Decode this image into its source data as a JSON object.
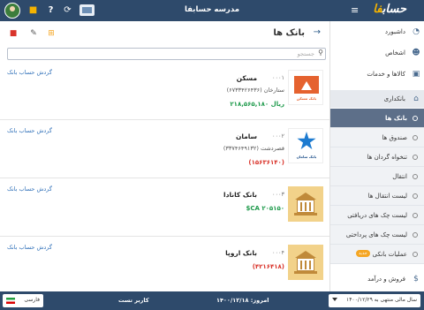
{
  "header": {
    "app_title": "مدرسه حسابفا",
    "logo_text_main": "حساب",
    "logo_text_accent": "فا"
  },
  "sidebar": {
    "items": [
      {
        "label": "داشبورد",
        "icon": "dashboard-icon"
      },
      {
        "label": "اشخاص",
        "icon": "people-icon"
      },
      {
        "label": "کالاها و خدمات",
        "icon": "products-icon"
      },
      {
        "label": "بانکداری",
        "icon": "bank-icon"
      }
    ],
    "sub_items": [
      {
        "label": "بانک ها",
        "active": true
      },
      {
        "label": "صندوق ها"
      },
      {
        "label": "تنخواه گردان ها"
      },
      {
        "label": "انتقال"
      },
      {
        "label": "لیست انتقال ها"
      },
      {
        "label": "لیست چک های دریافتی"
      },
      {
        "label": "لیست چک های پرداختی"
      },
      {
        "label": "عملیات بانکی",
        "badge": "جدید"
      }
    ],
    "bottom_item": {
      "label": "فروش و درآمد",
      "icon": "sales-icon"
    }
  },
  "main": {
    "page_title": "بانک ها",
    "search_placeholder": "جستجو",
    "banks": [
      {
        "code": "۰۰۰۱",
        "name": "مسکن",
        "branch": "ستارخان (۶۷۳۳۴۲۶۴۳۶)",
        "balance": "ریال ۲۱۸,۵۶۵,۱۸۰",
        "balance_color": "green",
        "logo": "maskan",
        "turnover": "گردش حساب بانک"
      },
      {
        "code": "۰۰۰۲",
        "name": "سامان",
        "branch": "قصردشت (۳۳۷۴۶۴۹۱۳۲)",
        "balance": "(۱۵۶۳۶۱۴۰)",
        "balance_color": "red",
        "logo": "saman",
        "turnover": "گردش حساب بانک"
      },
      {
        "code": "۰۰۰۳",
        "name": "بانک کانادا",
        "branch": "",
        "balance": "$CA ۲۰۵۱۵۰",
        "balance_color": "green",
        "logo": "generic",
        "turnover": "گردش حساب بانک"
      },
      {
        "code": "۰۰۰۴",
        "name": "بانک اروپا",
        "branch": "",
        "balance": "(۴۲۱۶۴۱۸)",
        "balance_color": "red",
        "logo": "generic",
        "turnover": "گردش حساب بانک"
      }
    ],
    "maskan_logo_caption": "بانک مسکن",
    "saman_logo_caption": "بانک سامان"
  },
  "footer": {
    "fiscal_year": "سال مالی منتهی به ۱۴۰۰/۱۲/۲۹",
    "user": "کاربر تست",
    "today": "امروز: ۱۴۰۰/۱۲/۱۸",
    "language": "فارسی"
  },
  "colors": {
    "header_bg": "#2e4a6b",
    "accent": "#f5b300",
    "positive": "#1e9a4b",
    "negative": "#d9342b",
    "link": "#2e6fb8"
  }
}
